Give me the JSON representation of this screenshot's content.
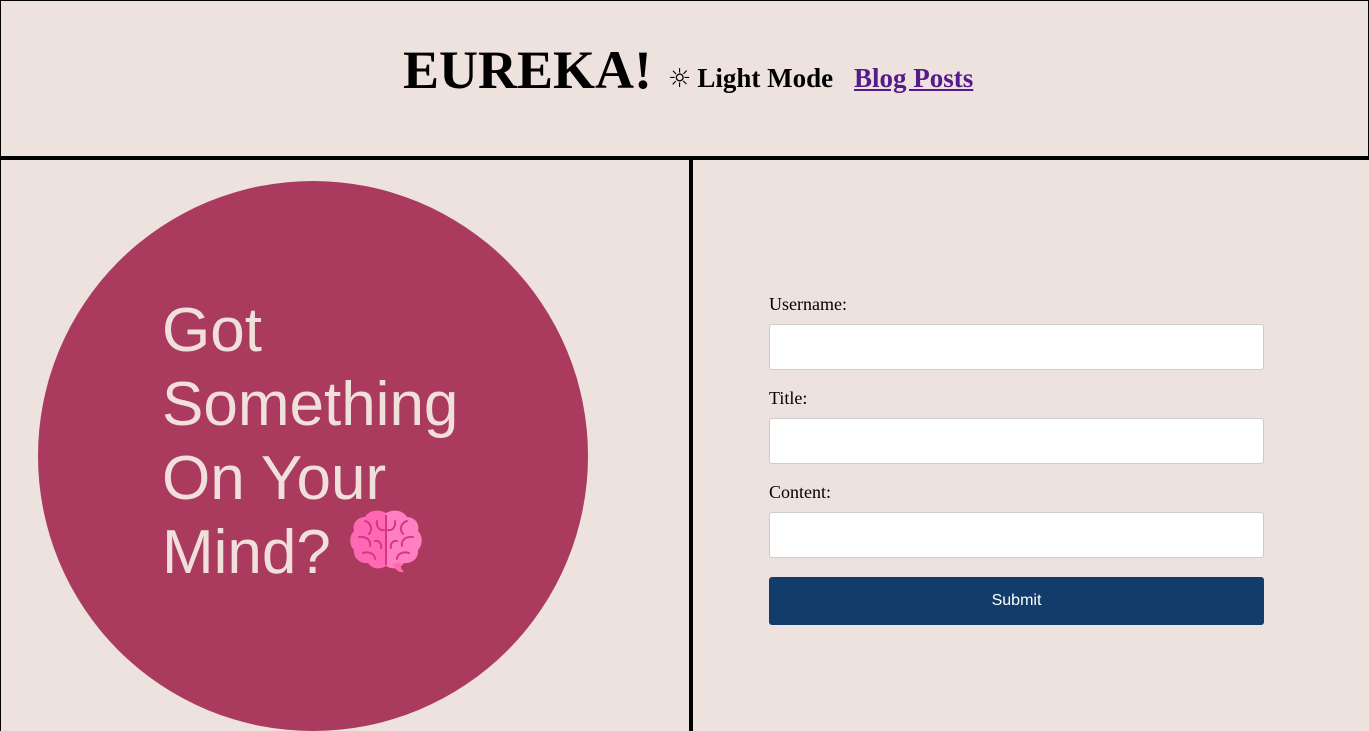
{
  "header": {
    "brand": "EUREKA!",
    "mode_icon": "☼",
    "mode_label": "Light Mode",
    "blog_link": "Blog Posts"
  },
  "hero": {
    "line1": "Got",
    "line2": "Something",
    "line3": "On Your",
    "line4": "Mind?",
    "icon": "brain-icon"
  },
  "form": {
    "username_label": "Username:",
    "username_value": "",
    "title_label": "Title:",
    "title_value": "",
    "content_label": "Content:",
    "content_value": "",
    "submit_label": "Submit"
  },
  "colors": {
    "background": "#ede2dd",
    "circle": "#aa3a5e",
    "hero_text": "#f1dfdb",
    "submit_bg": "#123d6a",
    "link": "#551a8b"
  }
}
